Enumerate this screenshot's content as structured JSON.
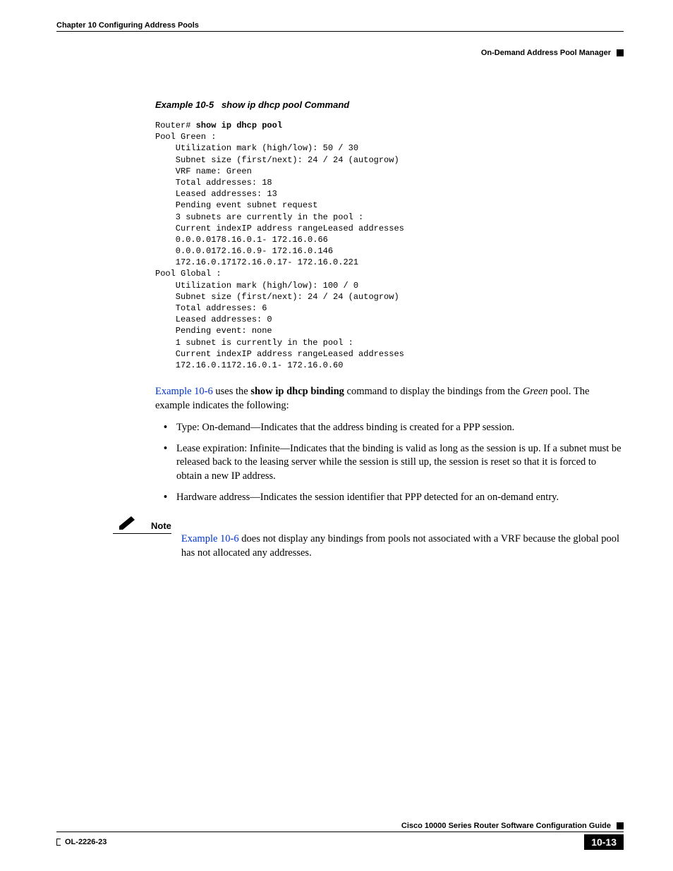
{
  "header": {
    "chapter": "Chapter 10      Configuring Address Pools",
    "section": "On-Demand Address Pool Manager"
  },
  "example": {
    "label": "Example 10-5",
    "title": "show ip dhcp pool Command",
    "prompt": "Router# ",
    "command": "show ip dhcp pool",
    "output": "\nPool Green :\n    Utilization mark (high/low): 50 / 30\n    Subnet size (first/next): 24 / 24 (autogrow)\n    VRF name: Green\n    Total addresses: 18\n    Leased addresses: 13\n    Pending event subnet request\n    3 subnets are currently in the pool :\n    Current indexIP address rangeLeased addresses\n    0.0.0.0178.16.0.1- 172.16.0.66\n    0.0.0.0172.16.0.9- 172.16.0.146\n    172.16.0.17172.16.0.17- 172.16.0.221\nPool Global :\n    Utilization mark (high/low): 100 / 0\n    Subnet size (first/next): 24 / 24 (autogrow)\n    Total addresses: 6\n    Leased addresses: 0\n    Pending event: none\n    1 subnet is currently in the pool :\n    Current indexIP address rangeLeased addresses\n    172.16.0.1172.16.0.1- 172.16.0.60"
  },
  "para1_link": "Example 10-6",
  "para1_a": " uses the ",
  "para1_bold": "show ip dhcp binding",
  "para1_b": " command to display the bindings from the ",
  "para1_italic": "Green",
  "para1_c": " pool. The example indicates the following:",
  "bullets": {
    "b1": "Type: On-demand—Indicates that the address binding is created for a PPP session.",
    "b2": "Lease expiration: Infinite—Indicates that the binding is valid as long as the session is up. If a subnet must be released back to the leasing server while the session is still up, the session is reset so that it is forced to obtain a new IP address.",
    "b3": "Hardware address—Indicates the session identifier that PPP detected for an on-demand entry."
  },
  "note": {
    "label": "Note",
    "link": "Example 10-6",
    "rest": " does not display any bindings from pools not associated with a VRF because the global pool has not allocated any addresses."
  },
  "footer": {
    "guide": "Cisco 10000 Series Router Software Configuration Guide",
    "doc": "OL-2226-23",
    "page": "10-13"
  }
}
